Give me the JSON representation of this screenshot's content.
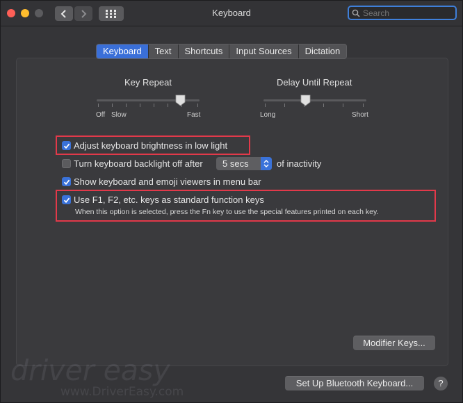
{
  "window": {
    "title": "Keyboard"
  },
  "search": {
    "placeholder": "Search"
  },
  "icons": {
    "back": "chevron-left-icon",
    "forward": "chevron-right-icon",
    "grid": "grid-icon",
    "search": "search-icon",
    "checkmark": "checkmark-icon",
    "popup": "up-down-arrows-icon"
  },
  "tabs": [
    {
      "label": "Keyboard",
      "active": true
    },
    {
      "label": "Text",
      "active": false
    },
    {
      "label": "Shortcuts",
      "active": false
    },
    {
      "label": "Input Sources",
      "active": false
    },
    {
      "label": "Dictation",
      "active": false
    }
  ],
  "key_repeat": {
    "label": "Key Repeat",
    "left_label": "Off",
    "left_label_2": "Slow",
    "right_label": "Fast"
  },
  "delay_until_repeat": {
    "label": "Delay Until Repeat",
    "left_label": "Long",
    "right_label": "Short"
  },
  "options": {
    "adjust_brightness": {
      "label": "Adjust keyboard brightness in low light",
      "checked": true
    },
    "backlight_off": {
      "label": "Turn keyboard backlight off after",
      "checked": false,
      "popup_value": "5 secs",
      "suffix": "of inactivity"
    },
    "show_viewers": {
      "label": "Show keyboard and emoji viewers in menu bar",
      "checked": true
    },
    "function_keys": {
      "label": "Use F1, F2, etc. keys as standard function keys",
      "checked": true,
      "note": "When this option is selected, press the Fn key to use the special features printed on each key."
    }
  },
  "buttons": {
    "modifier_keys": "Modifier Keys...",
    "bluetooth": "Set Up Bluetooth Keyboard...",
    "help": "?"
  },
  "watermark": {
    "brand": "driver easy",
    "url": "www.DriverEasy.com"
  },
  "colors": {
    "accent": "#3a72d9",
    "highlight_box": "#e2394a"
  }
}
